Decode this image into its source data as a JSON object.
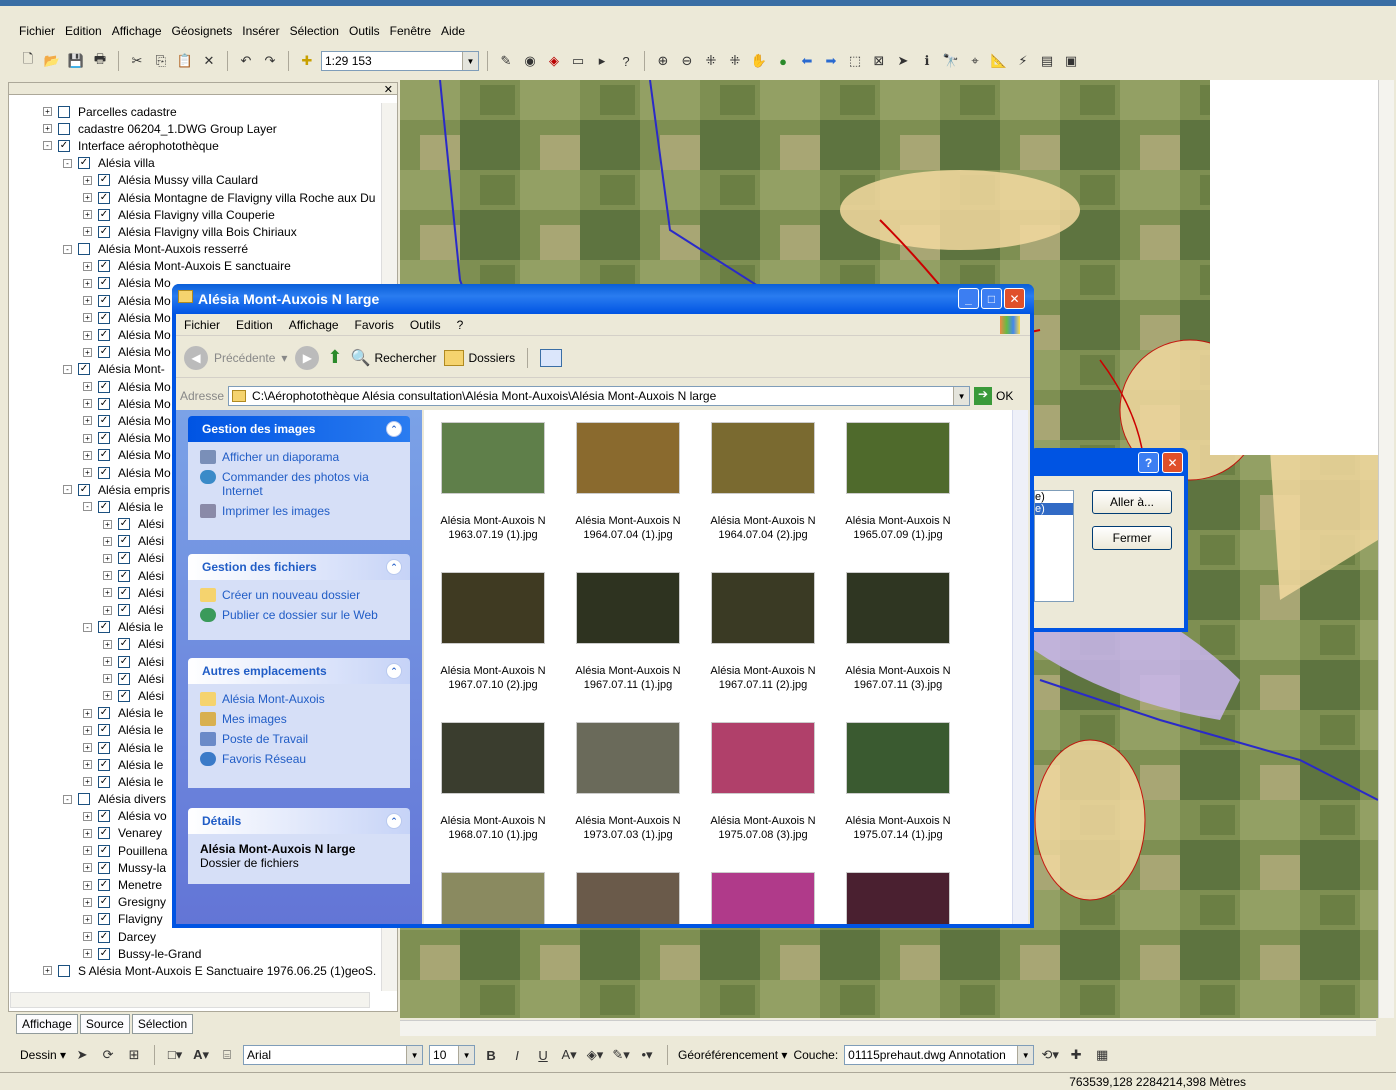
{
  "app": {
    "menu": [
      "Fichier",
      "Edition",
      "Affichage",
      "Géosignets",
      "Insérer",
      "Sélection",
      "Outils",
      "Fenêtre",
      "Aide"
    ],
    "scale": "1:29 153"
  },
  "toc": {
    "rows": [
      {
        "indent": 0,
        "pm": "+",
        "cb": "",
        "label": "Parcelles cadastre"
      },
      {
        "indent": 0,
        "pm": "+",
        "cb": "",
        "label": "cadastre 06204_1.DWG Group Layer"
      },
      {
        "indent": 0,
        "pm": "-",
        "cb": "✓",
        "label": "Interface aérophotothèque"
      },
      {
        "indent": 1,
        "pm": "-",
        "cb": "✓",
        "label": "Alésia villa"
      },
      {
        "indent": 2,
        "pm": "+",
        "cb": "✓",
        "label": "Alésia Mussy villa Caulard"
      },
      {
        "indent": 2,
        "pm": "+",
        "cb": "✓",
        "label": "Alésia Montagne de Flavigny villa Roche aux Du"
      },
      {
        "indent": 2,
        "pm": "+",
        "cb": "✓",
        "label": "Alésia Flavigny villa Couperie"
      },
      {
        "indent": 2,
        "pm": "+",
        "cb": "✓",
        "label": "Alésia Flavigny villa Bois Chiriaux"
      },
      {
        "indent": 1,
        "pm": "-",
        "cb": "",
        "label": "Alésia Mont-Auxois resserré"
      },
      {
        "indent": 2,
        "pm": "+",
        "cb": "✓",
        "label": "Alésia Mont-Auxois E sanctuaire"
      },
      {
        "indent": 2,
        "pm": "+",
        "cb": "✓",
        "label": "Alésia Mo"
      },
      {
        "indent": 2,
        "pm": "+",
        "cb": "✓",
        "label": "Alésia Mo"
      },
      {
        "indent": 2,
        "pm": "+",
        "cb": "✓",
        "label": "Alésia Mo"
      },
      {
        "indent": 2,
        "pm": "+",
        "cb": "✓",
        "label": "Alésia Mo"
      },
      {
        "indent": 2,
        "pm": "+",
        "cb": "✓",
        "label": "Alésia Mo"
      },
      {
        "indent": 1,
        "pm": "-",
        "cb": "✓",
        "label": "Alésia Mont-"
      },
      {
        "indent": 2,
        "pm": "+",
        "cb": "✓",
        "label": "Alésia Mo"
      },
      {
        "indent": 2,
        "pm": "+",
        "cb": "✓",
        "label": "Alésia Mo"
      },
      {
        "indent": 2,
        "pm": "+",
        "cb": "✓",
        "label": "Alésia Mo"
      },
      {
        "indent": 2,
        "pm": "+",
        "cb": "✓",
        "label": "Alésia Mo"
      },
      {
        "indent": 2,
        "pm": "+",
        "cb": "✓",
        "label": "Alésia Mo"
      },
      {
        "indent": 2,
        "pm": "+",
        "cb": "✓",
        "label": "Alésia Mo"
      },
      {
        "indent": 1,
        "pm": "-",
        "cb": "✓",
        "label": "Alésia empris"
      },
      {
        "indent": 2,
        "pm": "-",
        "cb": "✓",
        "label": "Alésia le"
      },
      {
        "indent": 3,
        "pm": "+",
        "cb": "✓",
        "label": "Alési"
      },
      {
        "indent": 3,
        "pm": "+",
        "cb": "✓",
        "label": "Alési"
      },
      {
        "indent": 3,
        "pm": "+",
        "cb": "✓",
        "label": "Alési"
      },
      {
        "indent": 3,
        "pm": "+",
        "cb": "✓",
        "label": "Alési"
      },
      {
        "indent": 3,
        "pm": "+",
        "cb": "✓",
        "label": "Alési"
      },
      {
        "indent": 3,
        "pm": "+",
        "cb": "✓",
        "label": "Alési"
      },
      {
        "indent": 2,
        "pm": "-",
        "cb": "✓",
        "label": "Alésia le"
      },
      {
        "indent": 3,
        "pm": "+",
        "cb": "✓",
        "label": "Alési"
      },
      {
        "indent": 3,
        "pm": "+",
        "cb": "✓",
        "label": "Alési"
      },
      {
        "indent": 3,
        "pm": "+",
        "cb": "✓",
        "label": "Alési"
      },
      {
        "indent": 3,
        "pm": "+",
        "cb": "✓",
        "label": "Alési"
      },
      {
        "indent": 2,
        "pm": "+",
        "cb": "✓",
        "label": "Alésia le"
      },
      {
        "indent": 2,
        "pm": "+",
        "cb": "✓",
        "label": "Alésia le"
      },
      {
        "indent": 2,
        "pm": "+",
        "cb": "✓",
        "label": "Alésia le"
      },
      {
        "indent": 2,
        "pm": "+",
        "cb": "✓",
        "label": "Alésia le"
      },
      {
        "indent": 2,
        "pm": "+",
        "cb": "✓",
        "label": "Alésia le"
      },
      {
        "indent": 1,
        "pm": "-",
        "cb": "",
        "label": "Alésia divers"
      },
      {
        "indent": 2,
        "pm": "+",
        "cb": "✓",
        "label": "Alésia vo"
      },
      {
        "indent": 2,
        "pm": "+",
        "cb": "✓",
        "label": "Venarey"
      },
      {
        "indent": 2,
        "pm": "+",
        "cb": "✓",
        "label": "Pouillena"
      },
      {
        "indent": 2,
        "pm": "+",
        "cb": "✓",
        "label": "Mussy-la"
      },
      {
        "indent": 2,
        "pm": "+",
        "cb": "✓",
        "label": "Menetre"
      },
      {
        "indent": 2,
        "pm": "+",
        "cb": "✓",
        "label": "Gresigny"
      },
      {
        "indent": 2,
        "pm": "+",
        "cb": "✓",
        "label": "Flavigny"
      },
      {
        "indent": 2,
        "pm": "+",
        "cb": "✓",
        "label": "Darcey"
      },
      {
        "indent": 2,
        "pm": "+",
        "cb": "✓",
        "label": "Bussy-le-Grand"
      },
      {
        "indent": 0,
        "pm": "+",
        "cb": "",
        "label": "S Alésia Mont-Auxois E Sanctuaire 1976.06.25 (1)geoS."
      }
    ],
    "tabs": [
      "Affichage",
      "Source",
      "Sélection"
    ]
  },
  "explorer": {
    "title": "Alésia Mont-Auxois N large",
    "menu": [
      "Fichier",
      "Edition",
      "Affichage",
      "Favoris",
      "Outils",
      "?"
    ],
    "back": "Précédente",
    "search": "Rechercher",
    "folders": "Dossiers",
    "address_label": "Adresse",
    "address": "C:\\Aérophotothèque Alésia consultation\\Alésia Mont-Auxois\\Alésia Mont-Auxois N large",
    "go": "OK",
    "panels": {
      "images": {
        "title": "Gestion des images",
        "links": [
          "Afficher un diaporama",
          "Commander des photos via Internet",
          "Imprimer les images"
        ]
      },
      "files": {
        "title": "Gestion des fichiers",
        "links": [
          "Créer un nouveau dossier",
          "Publier ce dossier sur le Web"
        ]
      },
      "places": {
        "title": "Autres emplacements",
        "links": [
          "Alésia Mont-Auxois",
          "Mes images",
          "Poste de Travail",
          "Favoris Réseau"
        ]
      },
      "details": {
        "title": "Détails",
        "name": "Alésia Mont-Auxois N large",
        "type": "Dossier de fichiers"
      }
    },
    "files": [
      {
        "l1": "Alésia Mont-Auxois N",
        "l2": "1963.07.19 (1).jpg",
        "color": "#5f7f4a"
      },
      {
        "l1": "Alésia Mont-Auxois N",
        "l2": "1964.07.04 (1).jpg",
        "color": "#8a6a2e"
      },
      {
        "l1": "Alésia Mont-Auxois N",
        "l2": "1964.07.04 (2).jpg",
        "color": "#7a6a30"
      },
      {
        "l1": "Alésia Mont-Auxois N",
        "l2": "1965.07.09 (1).jpg",
        "color": "#4f6a2c"
      },
      {
        "l1": "Alésia Mont-Auxois N",
        "l2": "1967.07.10 (2).jpg",
        "color": "#3f3a22"
      },
      {
        "l1": "Alésia Mont-Auxois N",
        "l2": "1967.07.11 (1).jpg",
        "color": "#2e3320"
      },
      {
        "l1": "Alésia Mont-Auxois N",
        "l2": "1967.07.11 (2).jpg",
        "color": "#3a3a24"
      },
      {
        "l1": "Alésia Mont-Auxois N",
        "l2": "1967.07.11 (3).jpg",
        "color": "#2f3622"
      },
      {
        "l1": "Alésia Mont-Auxois N",
        "l2": "1968.07.10 (1).jpg",
        "color": "#3a3d2e"
      },
      {
        "l1": "Alésia Mont-Auxois N",
        "l2": "1973.07.03 (1).jpg",
        "color": "#6a6a5a"
      },
      {
        "l1": "Alésia Mont-Auxois N",
        "l2": "1975.07.08 (3).jpg",
        "color": "#b0406a"
      },
      {
        "l1": "Alésia Mont-Auxois N",
        "l2": "1975.07.14 (1).jpg",
        "color": "#3a5a30"
      },
      {
        "l1": "",
        "l2": "",
        "color": "#8a8a60"
      },
      {
        "l1": "",
        "l2": "",
        "color": "#6a5a4a"
      },
      {
        "l1": "",
        "l2": "",
        "color": "#b03a8a"
      },
      {
        "l1": "",
        "l2": "",
        "color": "#4a2030"
      }
    ]
  },
  "goto": {
    "goto_btn": "Aller à...",
    "close_btn": "Fermer",
    "item1": "e)",
    "item2": "e)"
  },
  "draw": {
    "dessin": "Dessin ▾",
    "font": "Arial",
    "size": "10",
    "georef": "Géoréférencement ▾",
    "couche_label": "Couche:",
    "couche": "01115prehaut.dwg Annotation"
  },
  "status": {
    "coords": "763539,128  2284214,398 Mètres"
  }
}
